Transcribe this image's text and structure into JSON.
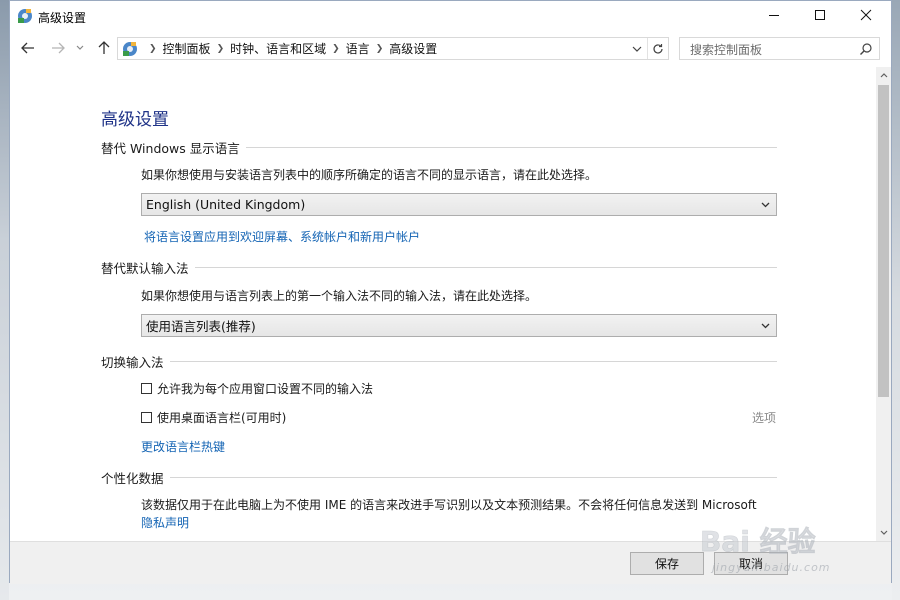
{
  "window": {
    "title": "高级设置"
  },
  "nav": {
    "breadcrumbs": [
      "控制面板",
      "时钟、语言和区域",
      "语言",
      "高级设置"
    ],
    "search_placeholder": "搜索控制面板"
  },
  "main": {
    "page_title": "高级设置",
    "display_language": {
      "header": "替代 Windows 显示语言",
      "description": "如果你想使用与安装语言列表中的顺序所确定的语言不同的显示语言，请在此处选择。",
      "selected": "English (United Kingdom)",
      "apply_link": "将语言设置应用到欢迎屏幕、系统帐户和新用户帐户"
    },
    "default_input": {
      "header": "替代默认输入法",
      "description": "如果你想使用与语言列表上的第一个输入法不同的输入法，请在此处选择。",
      "selected": "使用语言列表(推荐)"
    },
    "switch_input": {
      "header": "切换输入法",
      "checkbox_per_app": "允许我为每个应用窗口设置不同的输入法",
      "per_app_checked": false,
      "checkbox_language_bar": "使用桌面语言栏(可用时)",
      "language_bar_checked": false,
      "options_link": "选项",
      "hotkeys_link": "更改语言栏热键"
    },
    "personalization": {
      "header": "个性化数据",
      "description": "该数据仅用于在此电脑上为不使用 IME 的语言来改进手写识别以及文本预测结果。不会将任何信息发送到 Microsoft",
      "privacy_link": "隐私声明"
    }
  },
  "footer": {
    "save_label": "保存",
    "cancel_label": "取消"
  },
  "watermark": {
    "brand": "Bai 经验",
    "url": "jingyan.baidu.com"
  },
  "colors": {
    "title_blue": "#1e3287",
    "link_blue": "#1464b4",
    "window_border": "#9aa9bf"
  }
}
